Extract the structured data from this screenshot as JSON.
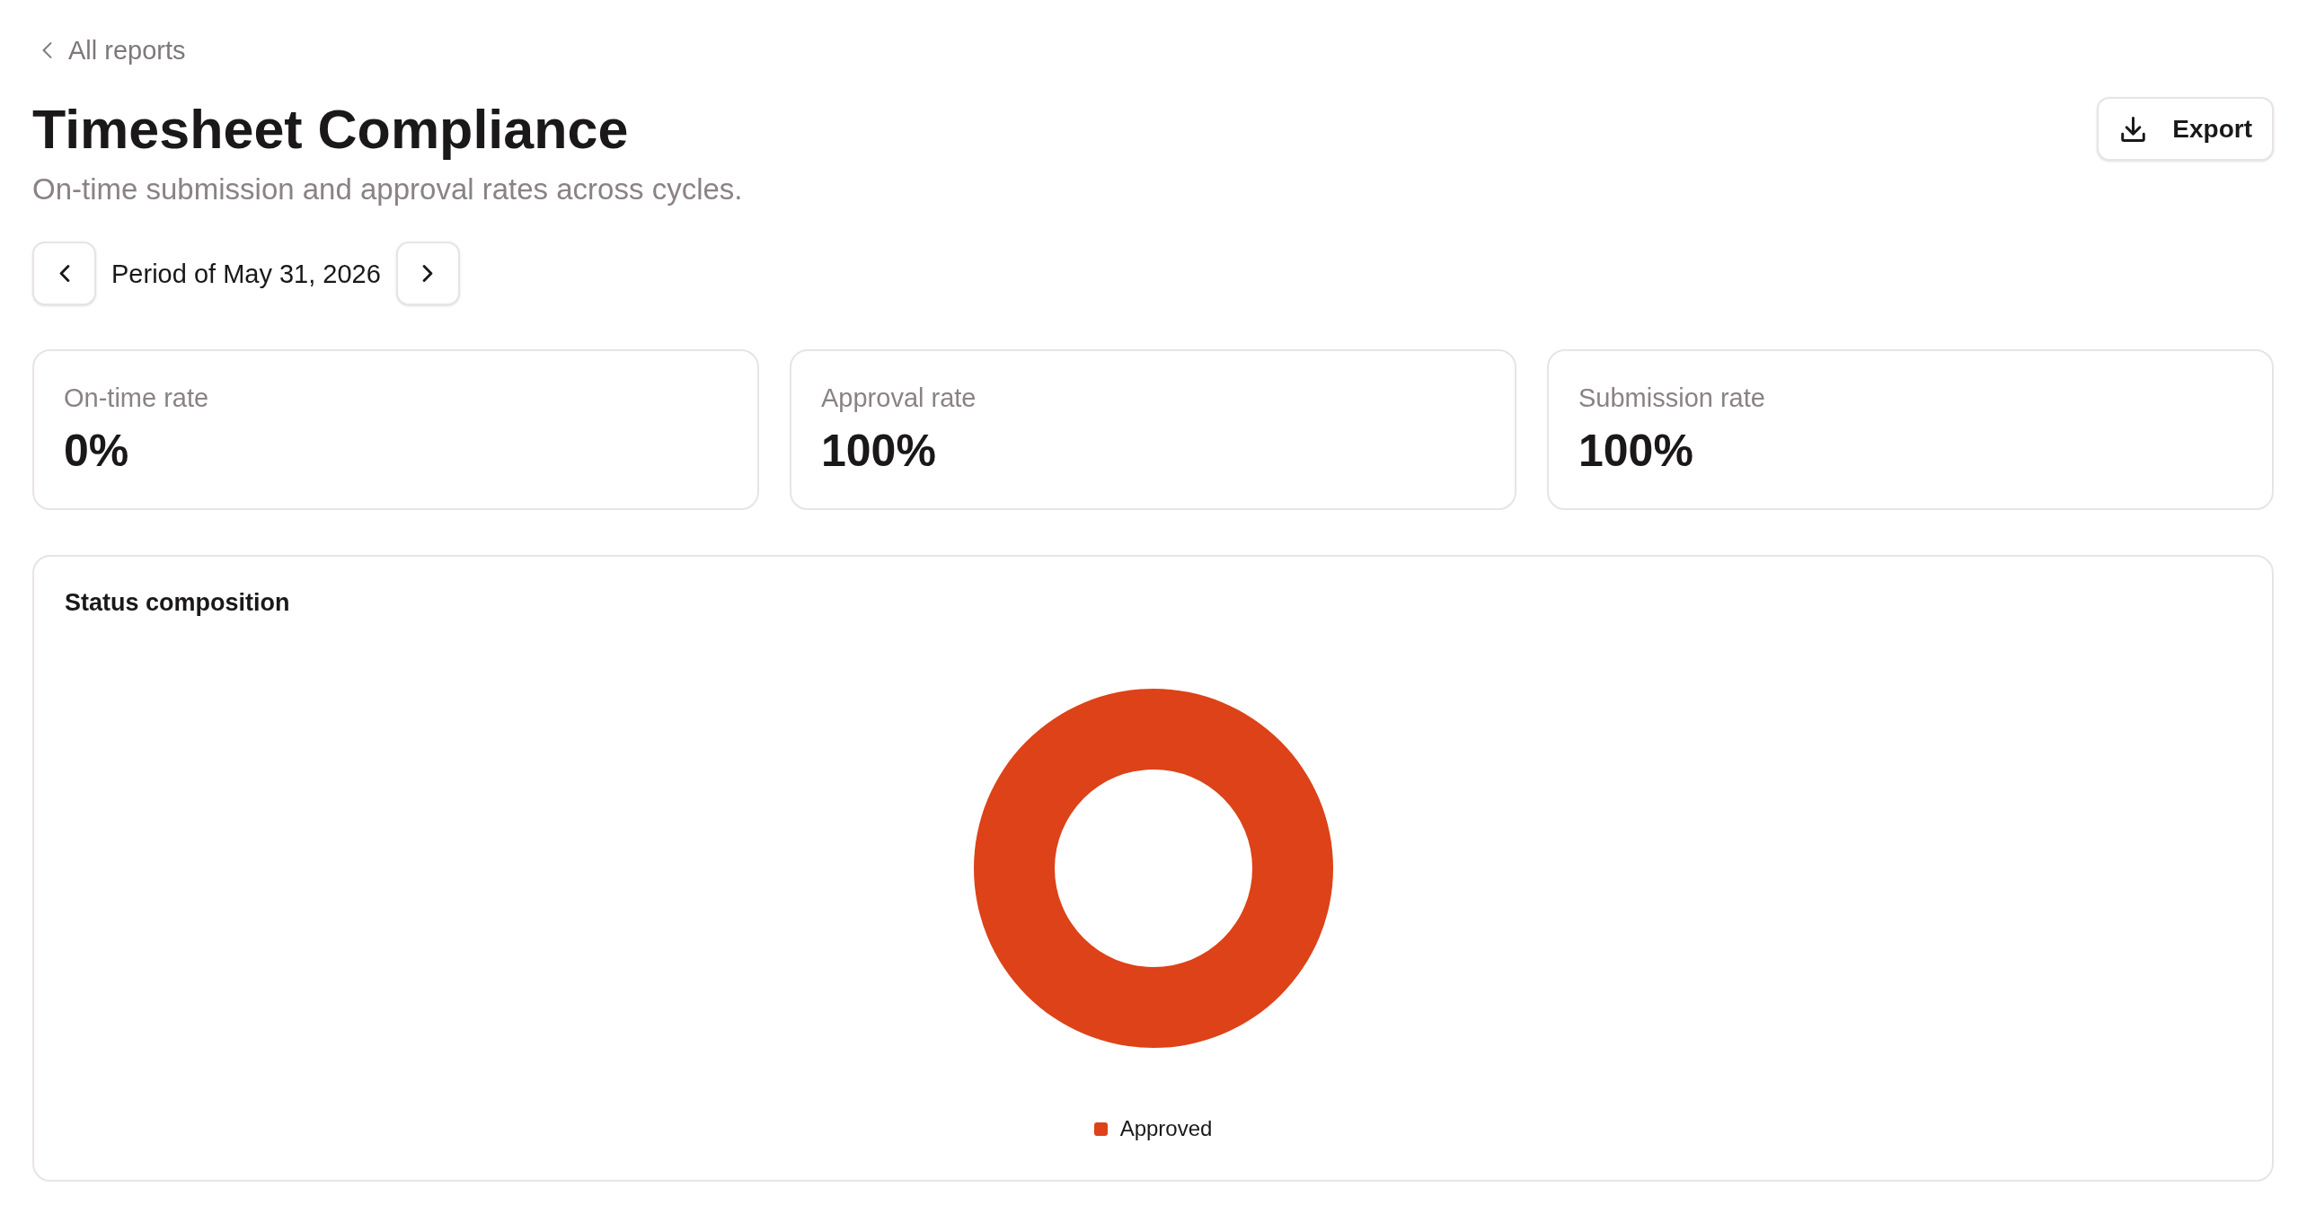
{
  "back_link": {
    "label": "All reports"
  },
  "header": {
    "title": "Timesheet Compliance",
    "subtitle": "On-time submission and approval rates across cycles.",
    "export_button": {
      "label": "Export"
    }
  },
  "period_nav": {
    "label": "Period of May 31, 2026"
  },
  "stats": [
    {
      "label": "On-time rate",
      "value": "0%"
    },
    {
      "label": "Approval rate",
      "value": "100%"
    },
    {
      "label": "Submission rate",
      "value": "100%"
    }
  ],
  "status_chart": {
    "title": "Status composition",
    "legend": [
      {
        "label": "Approved",
        "color": "#dd4218"
      }
    ]
  }
}
